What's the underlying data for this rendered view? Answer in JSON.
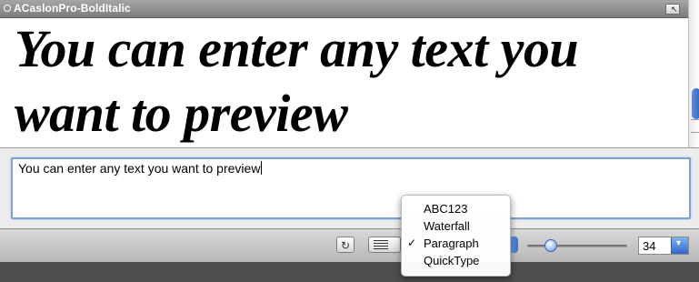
{
  "window": {
    "title": "ACaslonPro-BoldItalic"
  },
  "preview": {
    "text": "You can enter any text you want to preview"
  },
  "input": {
    "value": "You can enter any text you want to preview"
  },
  "toolbar": {
    "refresh_glyph": "↻",
    "size_value": "34",
    "size_arrow": "▾"
  },
  "preview_mode_menu": {
    "items": [
      {
        "label": "ABC123",
        "checked": false
      },
      {
        "label": "Waterfall",
        "checked": false
      },
      {
        "label": "Paragraph",
        "checked": true
      },
      {
        "label": "QuickType",
        "checked": false
      }
    ],
    "check_glyph": "✓"
  },
  "colors": {
    "accent": "#2f67c9"
  },
  "icons": {
    "title_button": "window-toolbar-toggle-icon",
    "refresh": "refresh-icon",
    "view_mode": "text-lines-icon"
  }
}
